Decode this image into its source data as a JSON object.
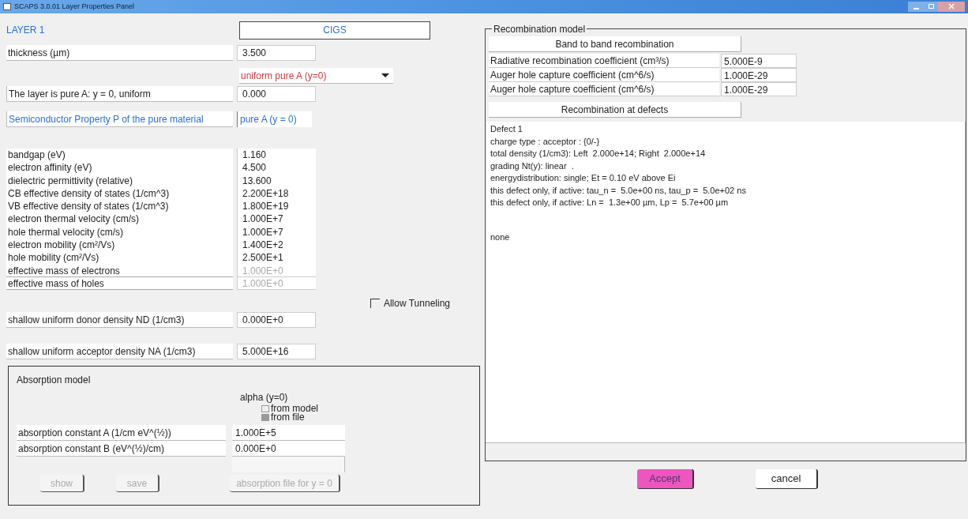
{
  "window": {
    "title": "SCAPS 3.0.01 Layer Properties Panel"
  },
  "layer": {
    "label": "LAYER 1",
    "name": "CIGS"
  },
  "thickness": {
    "label": "thickness (µm)",
    "value": "3.500"
  },
  "grading": {
    "value": "uniform pure A (y=0)"
  },
  "composition": {
    "label": "The layer is pure A: y = 0, uniform",
    "value": "0.000"
  },
  "property_header": {
    "label": "Semiconductor Property P of the pure material",
    "value": "pure A (y = 0)"
  },
  "properties": [
    {
      "label": "bandgap (eV)",
      "value": "1.160",
      "disabled": false
    },
    {
      "label": "electron affinity (eV)",
      "value": "4.500",
      "disabled": false
    },
    {
      "label": "dielectric permittivity (relative)",
      "value": "13.600",
      "disabled": false
    },
    {
      "label": "CB effective density of states (1/cm^3)",
      "value": "2.200E+18",
      "disabled": false
    },
    {
      "label": "VB effective density of states (1/cm^3)",
      "value": "1.800E+19",
      "disabled": false
    },
    {
      "label": "electron thermal velocity (cm/s)",
      "value": "1.000E+7",
      "disabled": false
    },
    {
      "label": "hole thermal velocity (cm/s)",
      "value": "1.000E+7",
      "disabled": false
    },
    {
      "label": "electron mobility (cm²/Vs)",
      "value": "1.400E+2",
      "disabled": false
    },
    {
      "label": "hole mobility (cm²/Vs)",
      "value": "2.500E+1",
      "disabled": false
    },
    {
      "label": "effective mass of electrons",
      "value": "1.000E+0",
      "disabled": true
    },
    {
      "label": "effective mass of holes",
      "value": "1.000E+0",
      "disabled": true
    }
  ],
  "allow_tunneling": {
    "label": "Allow Tunneling",
    "checked": false
  },
  "donor": {
    "label": "shallow uniform donor density ND (1/cm3)",
    "value": "0.000E+0"
  },
  "acceptor": {
    "label": "shallow uniform acceptor density NA (1/cm3)",
    "value": "5.000E+16"
  },
  "absorption": {
    "title": "Absorption model",
    "alpha_label": "alpha (y=0)",
    "options": [
      {
        "label": "from model",
        "selected": false
      },
      {
        "label": "from file",
        "selected": true
      }
    ],
    "constants": [
      {
        "label": "absorption constant A (1/cm eV^(½))",
        "value": "1.000E+5"
      },
      {
        "label": "absorption constant B (eV^(½)/cm)",
        "value": "0.000E+0"
      }
    ],
    "buttons": [
      {
        "label": "show",
        "disabled": true
      },
      {
        "label": "save",
        "disabled": true
      },
      {
        "label": "absorption file for y = 0",
        "disabled": true
      }
    ]
  },
  "recombination": {
    "title": "Recombination model",
    "band_header": "Band to band recombination",
    "coefficients": [
      {
        "label": "Radiative recombination coefficient (cm³/s)",
        "value": "5.000E-9"
      },
      {
        "label": "Auger hole capture coefficient (cm^6/s)",
        "value": "1.000E-29"
      },
      {
        "label": "Auger hole capture coefficient (cm^6/s)",
        "value": "1.000E-29"
      }
    ],
    "defects_header": "Recombination at defects",
    "defect_lines": [
      "Defect 1",
      "charge type : acceptor : {0/-}",
      "total density (1/cm3): Left  2.000e+14; Right  2.000e+14",
      "grading Nt(y): linear  .",
      "energydistribution: single; Et = 0.10 eV above Ei",
      "this defect only, if active: tau_n =  5.0e+00 ns, tau_p =  5.0e+02 ns",
      "this defect only, if active: Ln =  1.3e+00 µm, Lp =  5.7e+00 µm"
    ],
    "extra_text": "none"
  },
  "actions": [
    {
      "label": "Accept",
      "primary": true
    },
    {
      "label": "cancel",
      "primary": false
    }
  ]
}
